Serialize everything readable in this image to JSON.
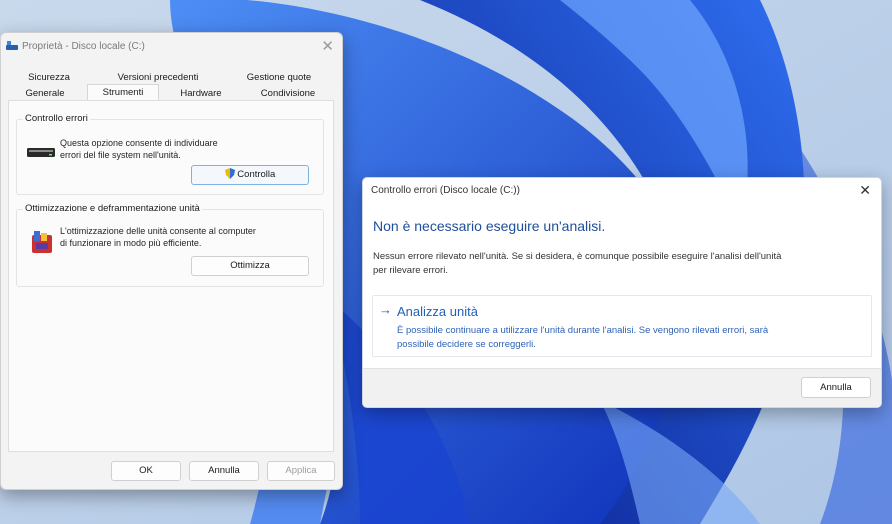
{
  "properties_window": {
    "title": "Proprietà - Disco locale (C:)",
    "tabs_row1": [
      "Sicurezza",
      "Versioni precedenti",
      "Gestione quote"
    ],
    "tabs_row2": [
      "Generale",
      "Strumenti",
      "Hardware",
      "Condivisione"
    ],
    "active_tab": "Strumenti",
    "error_check": {
      "title": "Controllo errori",
      "description_line1": "Questa opzione consente di individuare",
      "description_line2": "errori del file system nell'unità.",
      "button_label": "Controlla"
    },
    "optimize": {
      "title": "Ottimizzazione e deframmentazione unità",
      "description_line1": "L'ottimizzazione delle unità consente al computer",
      "description_line2": "di funzionare in modo più efficiente.",
      "button_label": "Ottimizza"
    },
    "footer": {
      "ok_label": "OK",
      "cancel_label": "Annulla",
      "apply_label": "Applica"
    }
  },
  "error_dialog": {
    "title": "Controllo errori (Disco locale (C:))",
    "heading": "Non è necessario eseguire un'analisi.",
    "body_line1": "Nessun errore rilevato nell'unità. Se si desidera, è comunque possibile eseguire l'analisi dell'unità",
    "body_line2": "per rilevare errori.",
    "action": {
      "title": "Analizza unità",
      "desc_line1": "È possibile continuare a utilizzare l'unità durante l'analisi. Se vengono rilevati errori, sarà",
      "desc_line2": "possibile decidere se correggerli."
    },
    "cancel_label": "Annulla"
  },
  "icons": [
    "drive-icon",
    "shield-icon",
    "defrag-icon",
    "close-icon",
    "arrow-right-icon"
  ],
  "colors": {
    "accent": "#2460b7",
    "heading": "#1f4e9b",
    "wallpaper": "#1f4fd6"
  }
}
